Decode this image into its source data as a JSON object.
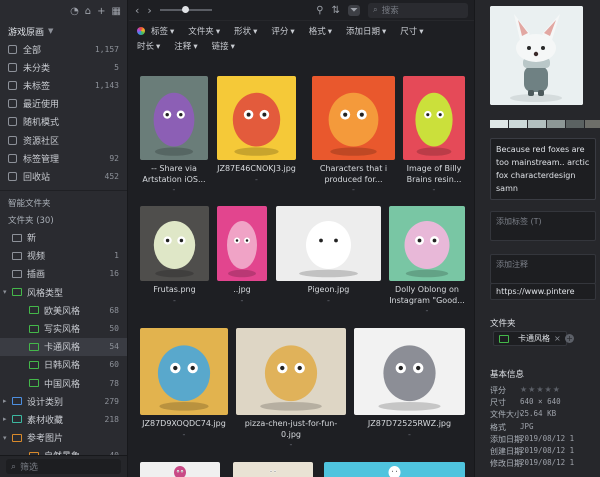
{
  "sidebar": {
    "library_name": "游戏原画",
    "top_icons": [
      "bell-icon",
      "bookmark-icon",
      "plus-icon",
      "grid-icon"
    ],
    "items": [
      {
        "label": "全部",
        "count": "1,157",
        "icon": "all-icon"
      },
      {
        "label": "未分类",
        "count": "5",
        "icon": "uncategorized-icon"
      },
      {
        "label": "未标签",
        "count": "1,143",
        "icon": "untagged-icon"
      },
      {
        "label": "最近使用",
        "count": "",
        "icon": "clock-icon"
      },
      {
        "label": "随机模式",
        "count": "",
        "icon": "shuffle-icon"
      },
      {
        "label": "资源社区",
        "count": "",
        "icon": "community-icon"
      },
      {
        "label": "标签管理",
        "count": "92",
        "icon": "tag-icon"
      },
      {
        "label": "回收站",
        "count": "452",
        "icon": "trash-icon"
      }
    ],
    "smart_folders_label": "智能文件夹",
    "folders_label": "文件夹 (30)",
    "folders": [
      {
        "label": "新",
        "count": "",
        "color": "#8d9199",
        "indent": 0,
        "twisty": ""
      },
      {
        "label": "视频",
        "count": "1",
        "color": "#8d9199",
        "indent": 0,
        "twisty": ""
      },
      {
        "label": "插画",
        "count": "16",
        "color": "#8d9199",
        "indent": 0,
        "twisty": ""
      },
      {
        "label": "风格类型",
        "count": "",
        "color": "#44b84a",
        "indent": 0,
        "twisty": "▾"
      },
      {
        "label": "欧美风格",
        "count": "68",
        "color": "#44b84a",
        "indent": 1,
        "twisty": ""
      },
      {
        "label": "写实风格",
        "count": "50",
        "color": "#44b84a",
        "indent": 1,
        "twisty": ""
      },
      {
        "label": "卡通风格",
        "count": "54",
        "color": "#44b84a",
        "indent": 1,
        "twisty": "",
        "selected": true
      },
      {
        "label": "日韩风格",
        "count": "60",
        "color": "#44b84a",
        "indent": 1,
        "twisty": ""
      },
      {
        "label": "中国风格",
        "count": "78",
        "color": "#44b84a",
        "indent": 1,
        "twisty": ""
      },
      {
        "label": "设计类别",
        "count": "279",
        "color": "#4d8fe0",
        "indent": 0,
        "twisty": "▸"
      },
      {
        "label": "素材收藏",
        "count": "218",
        "color": "#3cb8a0",
        "indent": 0,
        "twisty": "▸"
      },
      {
        "label": "参考图片",
        "count": "",
        "color": "#d98a2b",
        "indent": 0,
        "twisty": "▾"
      },
      {
        "label": "自然景象",
        "count": "40",
        "color": "#d98a2b",
        "indent": 1,
        "twisty": ""
      }
    ],
    "filter_placeholder": "筛选"
  },
  "toolbar": {
    "search_placeholder": "搜索",
    "filters_row1": [
      "标签",
      "文件夹",
      "形状",
      "评分",
      "格式",
      "添加日期",
      "尺寸"
    ],
    "filters_row2": [
      "时长",
      "注释",
      "链接"
    ]
  },
  "grid": {
    "items": [
      {
        "caption": "-- Share via Artstation iOS...",
        "sub": "-",
        "bg": "#6a7d79",
        "art": "#8c5fb5"
      },
      {
        "caption": "JZ87E46CNOKJ3.jpg",
        "sub": "-",
        "bg": "#f5c938",
        "art": "#e35b3c"
      },
      {
        "caption": "Characters that i produced for...",
        "sub": "-",
        "bg": "#e9582d",
        "art": "#f49a3b"
      },
      {
        "caption": "Image of Billy Brains resin...",
        "sub": "-",
        "bg": "#e54a58",
        "art": "#cbe03b"
      },
      {
        "caption": "Frutas.png",
        "sub": "-",
        "bg": "#4f4e4c",
        "art": "#dfe7c7"
      },
      {
        "caption": "..jpg",
        "sub": "-",
        "bg": "#e2458e",
        "art": "#f0a3c6"
      },
      {
        "caption": "Pigeon.jpg",
        "sub": "-",
        "bg": "#ededed",
        "art": "#ffffff"
      },
      {
        "caption": "Dolly Oblong on Instagram \"Good...",
        "sub": "-",
        "bg": "#79c6a4",
        "art": "#e8b8d8"
      },
      {
        "caption": "JZ87D9XOQDC74.jpg",
        "sub": "-",
        "bg": "#e2b34e",
        "art": "#59a8cc"
      },
      {
        "caption": "pizza-chen-just-for-fun-0.jpg",
        "sub": "-",
        "bg": "#ded6c5",
        "art": "#e0b25a"
      },
      {
        "caption": "JZ87D72525RWZ.jpg",
        "sub": "-",
        "bg": "#f2f2f2",
        "art": "#8c8e96"
      },
      {
        "caption": "",
        "sub": "",
        "bg": "#f0f0f0",
        "art": "#c84a86"
      },
      {
        "caption": "",
        "sub": "",
        "bg": "#e9e2d4",
        "art": "#e9e2d4"
      },
      {
        "caption": "",
        "sub": "",
        "bg": "#4fc4de",
        "art": "#ffffff"
      }
    ]
  },
  "inspector": {
    "swatches": [
      "#dfe7e7",
      "#ccd9d9",
      "#b2bfbf",
      "#8d9796",
      "#5b6262",
      "#6d6e69",
      "#969994"
    ],
    "description": "Because red foxes are too mainstream.. arctic fox characterdesign samn",
    "tag_placeholder": "添加标签 (T)",
    "note_placeholder": "添加注释",
    "url": "https://www.pintere",
    "folder_heading": "文件夹",
    "folder_tag": "卡通风格",
    "basic_info_heading": "基本信息",
    "info": [
      {
        "key": "评分",
        "value": "",
        "stars": "★★★★★"
      },
      {
        "key": "尺寸",
        "value": "640 × 640"
      },
      {
        "key": "文件大小",
        "value": "25.64 KB"
      },
      {
        "key": "格式",
        "value": "JPG"
      },
      {
        "key": "添加日期",
        "value": "2019/08/12 1"
      },
      {
        "key": "创建日期",
        "value": "2019/08/12 1"
      },
      {
        "key": "修改日期",
        "value": "2019/08/12 1"
      }
    ]
  }
}
